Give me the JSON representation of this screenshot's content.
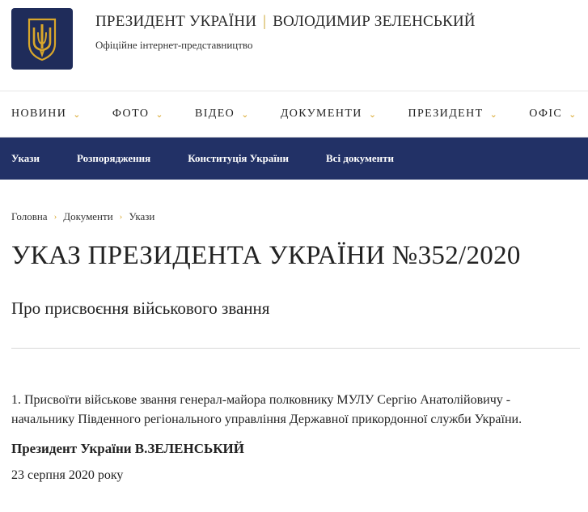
{
  "header": {
    "org": "ПРЕЗИДЕНТ УКРАЇНИ",
    "separator": "|",
    "person": "ВОЛОДИМИР ЗЕЛЕНСЬКИЙ",
    "subtitle": "Офіційне інтернет-представництво"
  },
  "main_nav": [
    {
      "label": "НОВИНИ",
      "icon": "chevron-down-icon"
    },
    {
      "label": "ФОТО",
      "icon": "chevron-down-icon"
    },
    {
      "label": "ВІДЕО",
      "icon": "chevron-down-icon"
    },
    {
      "label": "ДОКУМЕНТИ",
      "icon": "chevron-down-icon"
    },
    {
      "label": "ПРЕЗИДЕНТ",
      "icon": "chevron-down-icon"
    },
    {
      "label": "ОФІС",
      "icon": "chevron-down-icon"
    }
  ],
  "sub_nav": [
    "Укази",
    "Розпорядження",
    "Конституція України",
    "Всі документи"
  ],
  "breadcrumb": [
    "Головна",
    "Документи",
    "Укази"
  ],
  "page": {
    "title": "УКАЗ ПРЕЗИДЕНТА УКРАЇНИ №352/2020",
    "subtitle": "Про присвоєння військового звання",
    "paragraph": "1. Присвоїти військове звання генерал-майора полковнику МУЛУ Сергію Анатолійовичу - начальнику Південного регіонального управління Державної прикордонної служби України.",
    "signature": "Президент України В.ЗЕЛЕНСЬКИЙ",
    "date": "23 серпня 2020 року"
  },
  "colors": {
    "brand_navy": "#223166",
    "logo_bg": "#1f2c5a",
    "accent_gold": "#d9a72b"
  }
}
